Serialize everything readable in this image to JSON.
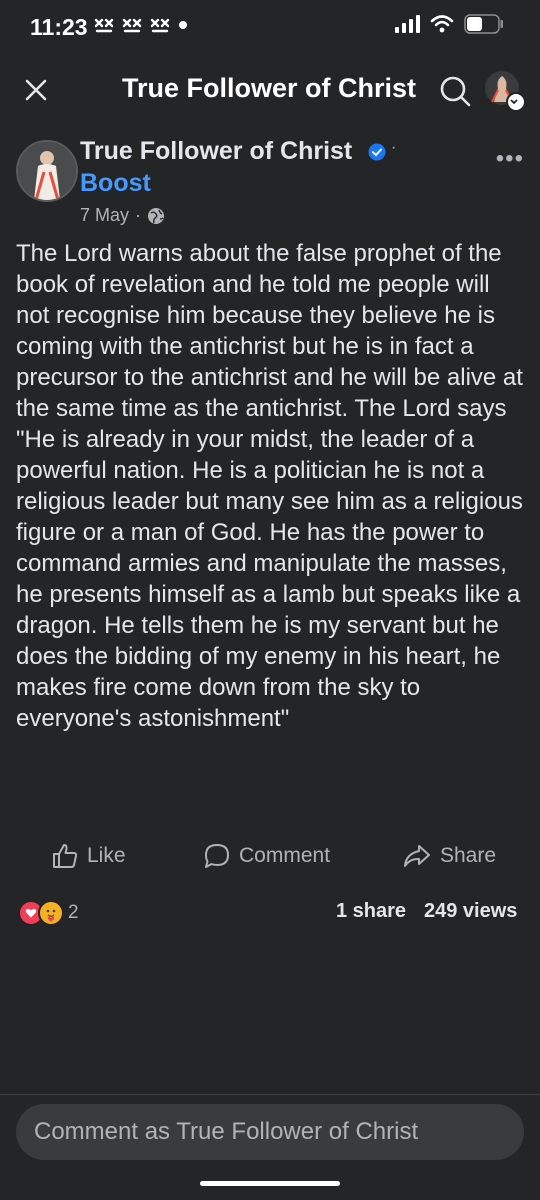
{
  "status_bar": {
    "time": "11:23"
  },
  "top_bar": {
    "title": "True Follower of Christ"
  },
  "post": {
    "page_name": "True Follower of Christ",
    "boost_label": "Boost",
    "date": "7 May",
    "separator": "·",
    "more_label": "•••",
    "body": "The Lord warns about the false prophet of the book of revelation and he told me people will not recognise him because they believe he is coming with the antichrist but he is in fact a precursor to the antichrist and he will be alive at the same time as the antichrist. The Lord says \"He is already in your midst, the leader of a powerful nation. He is a politician he is not a religious leader but many see him as a religious figure or a man of God. He has the power to command armies and manipulate the masses, he presents himself as a lamb but speaks like a dragon. He tells them he is my servant but he does the bidding of my enemy in his heart, he makes fire come down from the sky to everyone's astonishment\""
  },
  "actions": {
    "like": "Like",
    "comment": "Comment",
    "share": "Share"
  },
  "stats": {
    "reaction_count": "2",
    "shares": "1 share",
    "views": "249 views"
  },
  "comment_input": {
    "placeholder": "Comment as True Follower of Christ"
  },
  "colors": {
    "background": "#242526",
    "accent": "#4599ff",
    "verified": "#1877f2",
    "heart": "#f33e58"
  }
}
